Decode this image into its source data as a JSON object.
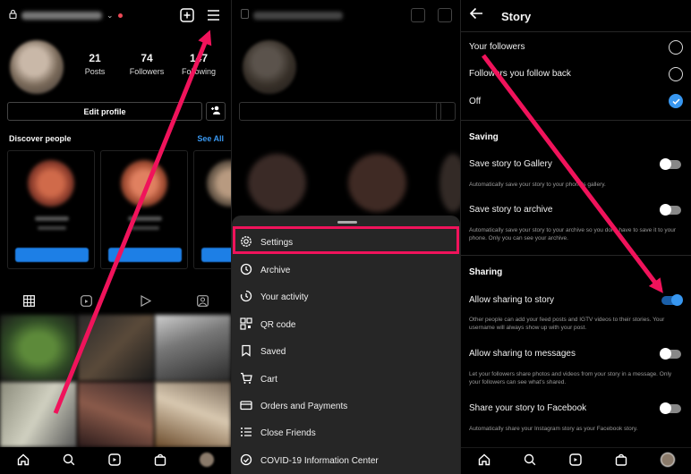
{
  "profile": {
    "stats": [
      {
        "value": "21",
        "label": "Posts"
      },
      {
        "value": "74",
        "label": "Followers"
      },
      {
        "value": "147",
        "label": "Following"
      }
    ],
    "edit_profile": "Edit profile",
    "discover_title": "Discover people",
    "see_all": "See All"
  },
  "menu": {
    "items": [
      {
        "label": "Settings",
        "icon": "settings-gear-icon"
      },
      {
        "label": "Archive",
        "icon": "archive-icon"
      },
      {
        "label": "Your activity",
        "icon": "activity-icon"
      },
      {
        "label": "QR code",
        "icon": "qr-code-icon"
      },
      {
        "label": "Saved",
        "icon": "bookmark-icon"
      },
      {
        "label": "Cart",
        "icon": "cart-icon"
      },
      {
        "label": "Orders and Payments",
        "icon": "card-icon"
      },
      {
        "label": "Close Friends",
        "icon": "list-icon"
      },
      {
        "label": "COVID-19 Information Center",
        "icon": "info-shield-icon"
      }
    ]
  },
  "story": {
    "title": "Story",
    "options": [
      {
        "label": "Your followers",
        "selected": false
      },
      {
        "label": "Followers you follow back",
        "selected": false
      },
      {
        "label": "Off",
        "selected": true
      }
    ],
    "saving_header": "Saving",
    "save_gallery": "Save story to Gallery",
    "save_gallery_desc": "Automatically save your story to your phone's gallery.",
    "save_archive": "Save story to archive",
    "save_archive_desc": "Automatically save your story to your archive so you don't have to save it to your phone. Only you can see your archive.",
    "sharing_header": "Sharing",
    "allow_story": "Allow sharing to story",
    "allow_story_desc": "Other people can add your feed posts and IGTV videos to their stories. Your username will always show up with your post.",
    "allow_messages": "Allow sharing to messages",
    "allow_messages_desc": "Let your followers share photos and videos from your story in a message. Only your followers can see what's shared.",
    "share_facebook": "Share your story to Facebook",
    "share_facebook_desc": "Automatically share your Instagram story as your Facebook story.",
    "toggles": {
      "save_gallery": false,
      "save_archive": false,
      "allow_story": true,
      "allow_messages": false,
      "share_facebook": false
    }
  },
  "colors": {
    "accent": "#3897f0",
    "highlight": "#f0135b"
  }
}
